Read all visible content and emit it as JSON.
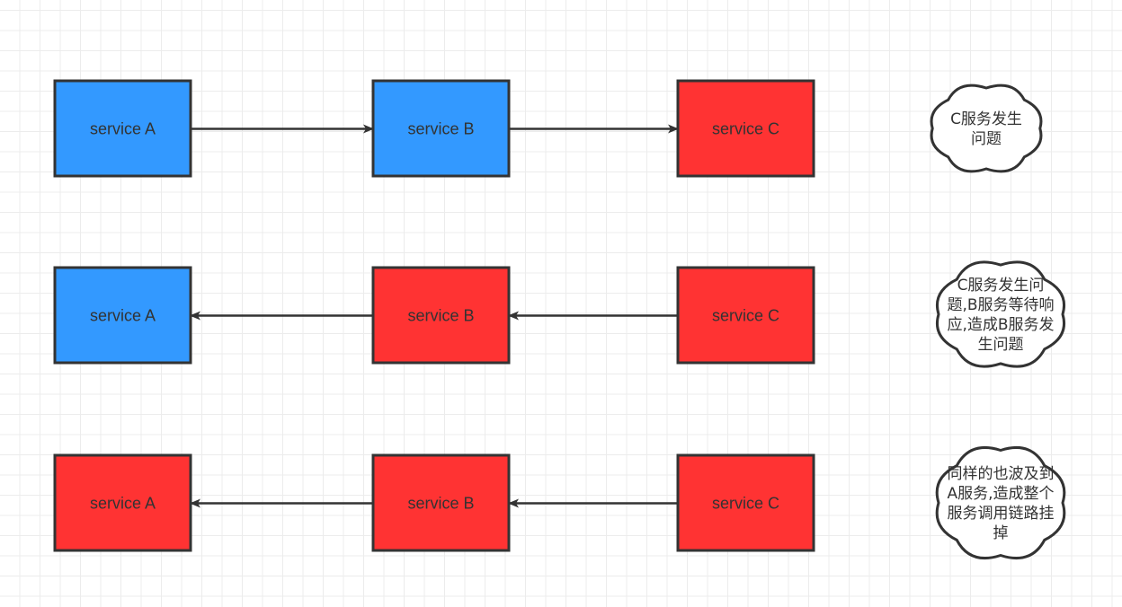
{
  "colors": {
    "healthy": "#3399ff",
    "failed": "#ff3333",
    "stroke": "#333333"
  },
  "rows": [
    {
      "services": [
        {
          "label": "service A",
          "status": "healthy"
        },
        {
          "label": "service B",
          "status": "healthy"
        },
        {
          "label": "service C",
          "status": "failed"
        }
      ],
      "arrow_direction": "right",
      "note": [
        "C服务发生",
        "问题"
      ]
    },
    {
      "services": [
        {
          "label": "service A",
          "status": "healthy"
        },
        {
          "label": "service B",
          "status": "failed"
        },
        {
          "label": "service C",
          "status": "failed"
        }
      ],
      "arrow_direction": "left",
      "note": [
        "C服务发生问",
        "题,B服务等待响",
        "应,造成B服务发",
        "生问题"
      ]
    },
    {
      "services": [
        {
          "label": "service A",
          "status": "failed"
        },
        {
          "label": "service B",
          "status": "failed"
        },
        {
          "label": "service C",
          "status": "failed"
        }
      ],
      "arrow_direction": "left",
      "note": [
        "同样的也波及到",
        "A服务,造成整个",
        "服务调用链路挂",
        "掉"
      ]
    }
  ]
}
